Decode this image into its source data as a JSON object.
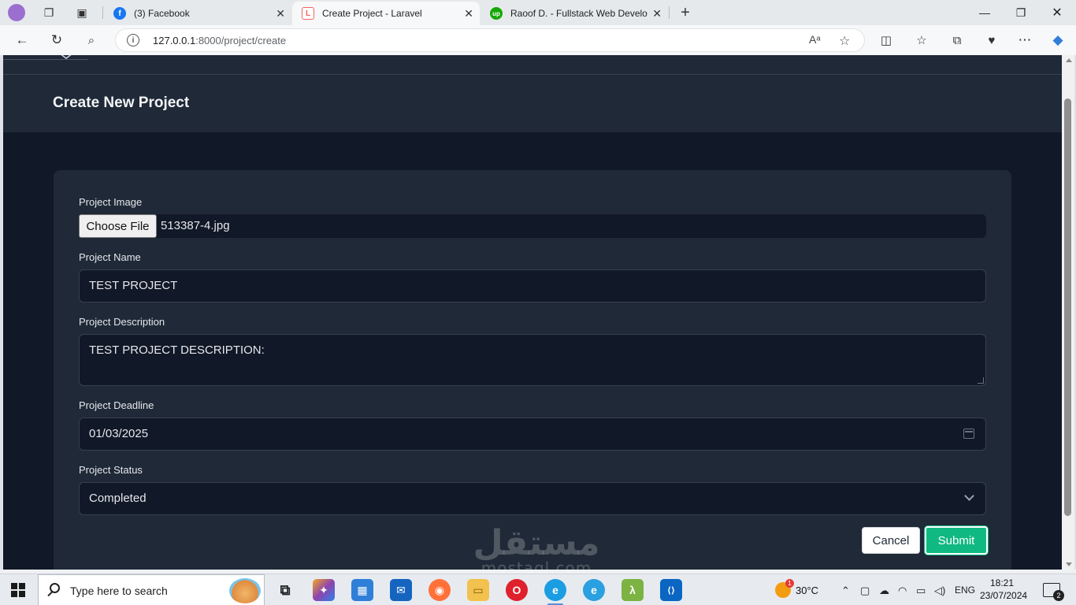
{
  "browser": {
    "tabs": [
      {
        "title": "(3) Facebook",
        "favicon": "facebook-icon",
        "color": "#1877f2",
        "glyph": "f"
      },
      {
        "title": "Create Project - Laravel",
        "favicon": "laravel-icon",
        "color": "#f4645f",
        "glyph": "L"
      },
      {
        "title": "Raoof D. - Fullstack Web Develop",
        "favicon": "upwork-icon",
        "color": "#14a800",
        "glyph": "up"
      }
    ],
    "new_tab_glyph": "+",
    "url_host": "127.0.0.1",
    "url_rest": ":8000/project/create"
  },
  "page": {
    "header_title": "Create New Project",
    "form": {
      "image_label": "Project Image",
      "choose_file_label": "Choose File",
      "file_name": "513387-4.jpg",
      "name_label": "Project Name",
      "name_value": "TEST PROJECT",
      "description_label": "Project Description",
      "description_value": "TEST PROJECT DESCRIPTION:",
      "deadline_label": "Project Deadline",
      "deadline_value": "01/03/2025",
      "status_label": "Project Status",
      "status_value": "Completed",
      "cancel_label": "Cancel",
      "submit_label": "Submit"
    }
  },
  "watermark": {
    "arabic": "مستقل",
    "latin": "mostaql.com"
  },
  "taskbar": {
    "search_placeholder": "Type here to search",
    "apps": [
      {
        "name": "task-view-icon",
        "color": "#3a3a3a",
        "glyph": "⧉"
      },
      {
        "name": "copilot-app-icon",
        "color": "#6b5ce7",
        "glyph": "✦"
      },
      {
        "name": "store-icon",
        "color": "#2f7fd8",
        "glyph": "▦"
      },
      {
        "name": "mail-icon",
        "color": "#1565c0",
        "glyph": "✉"
      },
      {
        "name": "firefox-icon",
        "color": "#ff7139",
        "glyph": "◉"
      },
      {
        "name": "file-explorer-icon",
        "color": "#f2c14e",
        "glyph": "▭"
      },
      {
        "name": "opera-icon",
        "color": "#e0202c",
        "glyph": "O"
      },
      {
        "name": "edge-icon",
        "color": "#1b9de2",
        "glyph": "e"
      },
      {
        "name": "edge-beta-icon",
        "color": "#2aa0e0",
        "glyph": "e"
      },
      {
        "name": "laragon-icon",
        "color": "#7cb342",
        "glyph": "λ"
      },
      {
        "name": "vscode-icon",
        "color": "#0a66c2",
        "glyph": "⟨⟩"
      }
    ],
    "temperature": "30°C",
    "language": "ENG",
    "time": "18:21",
    "date": "23/07/2024",
    "notification_count": "2"
  }
}
